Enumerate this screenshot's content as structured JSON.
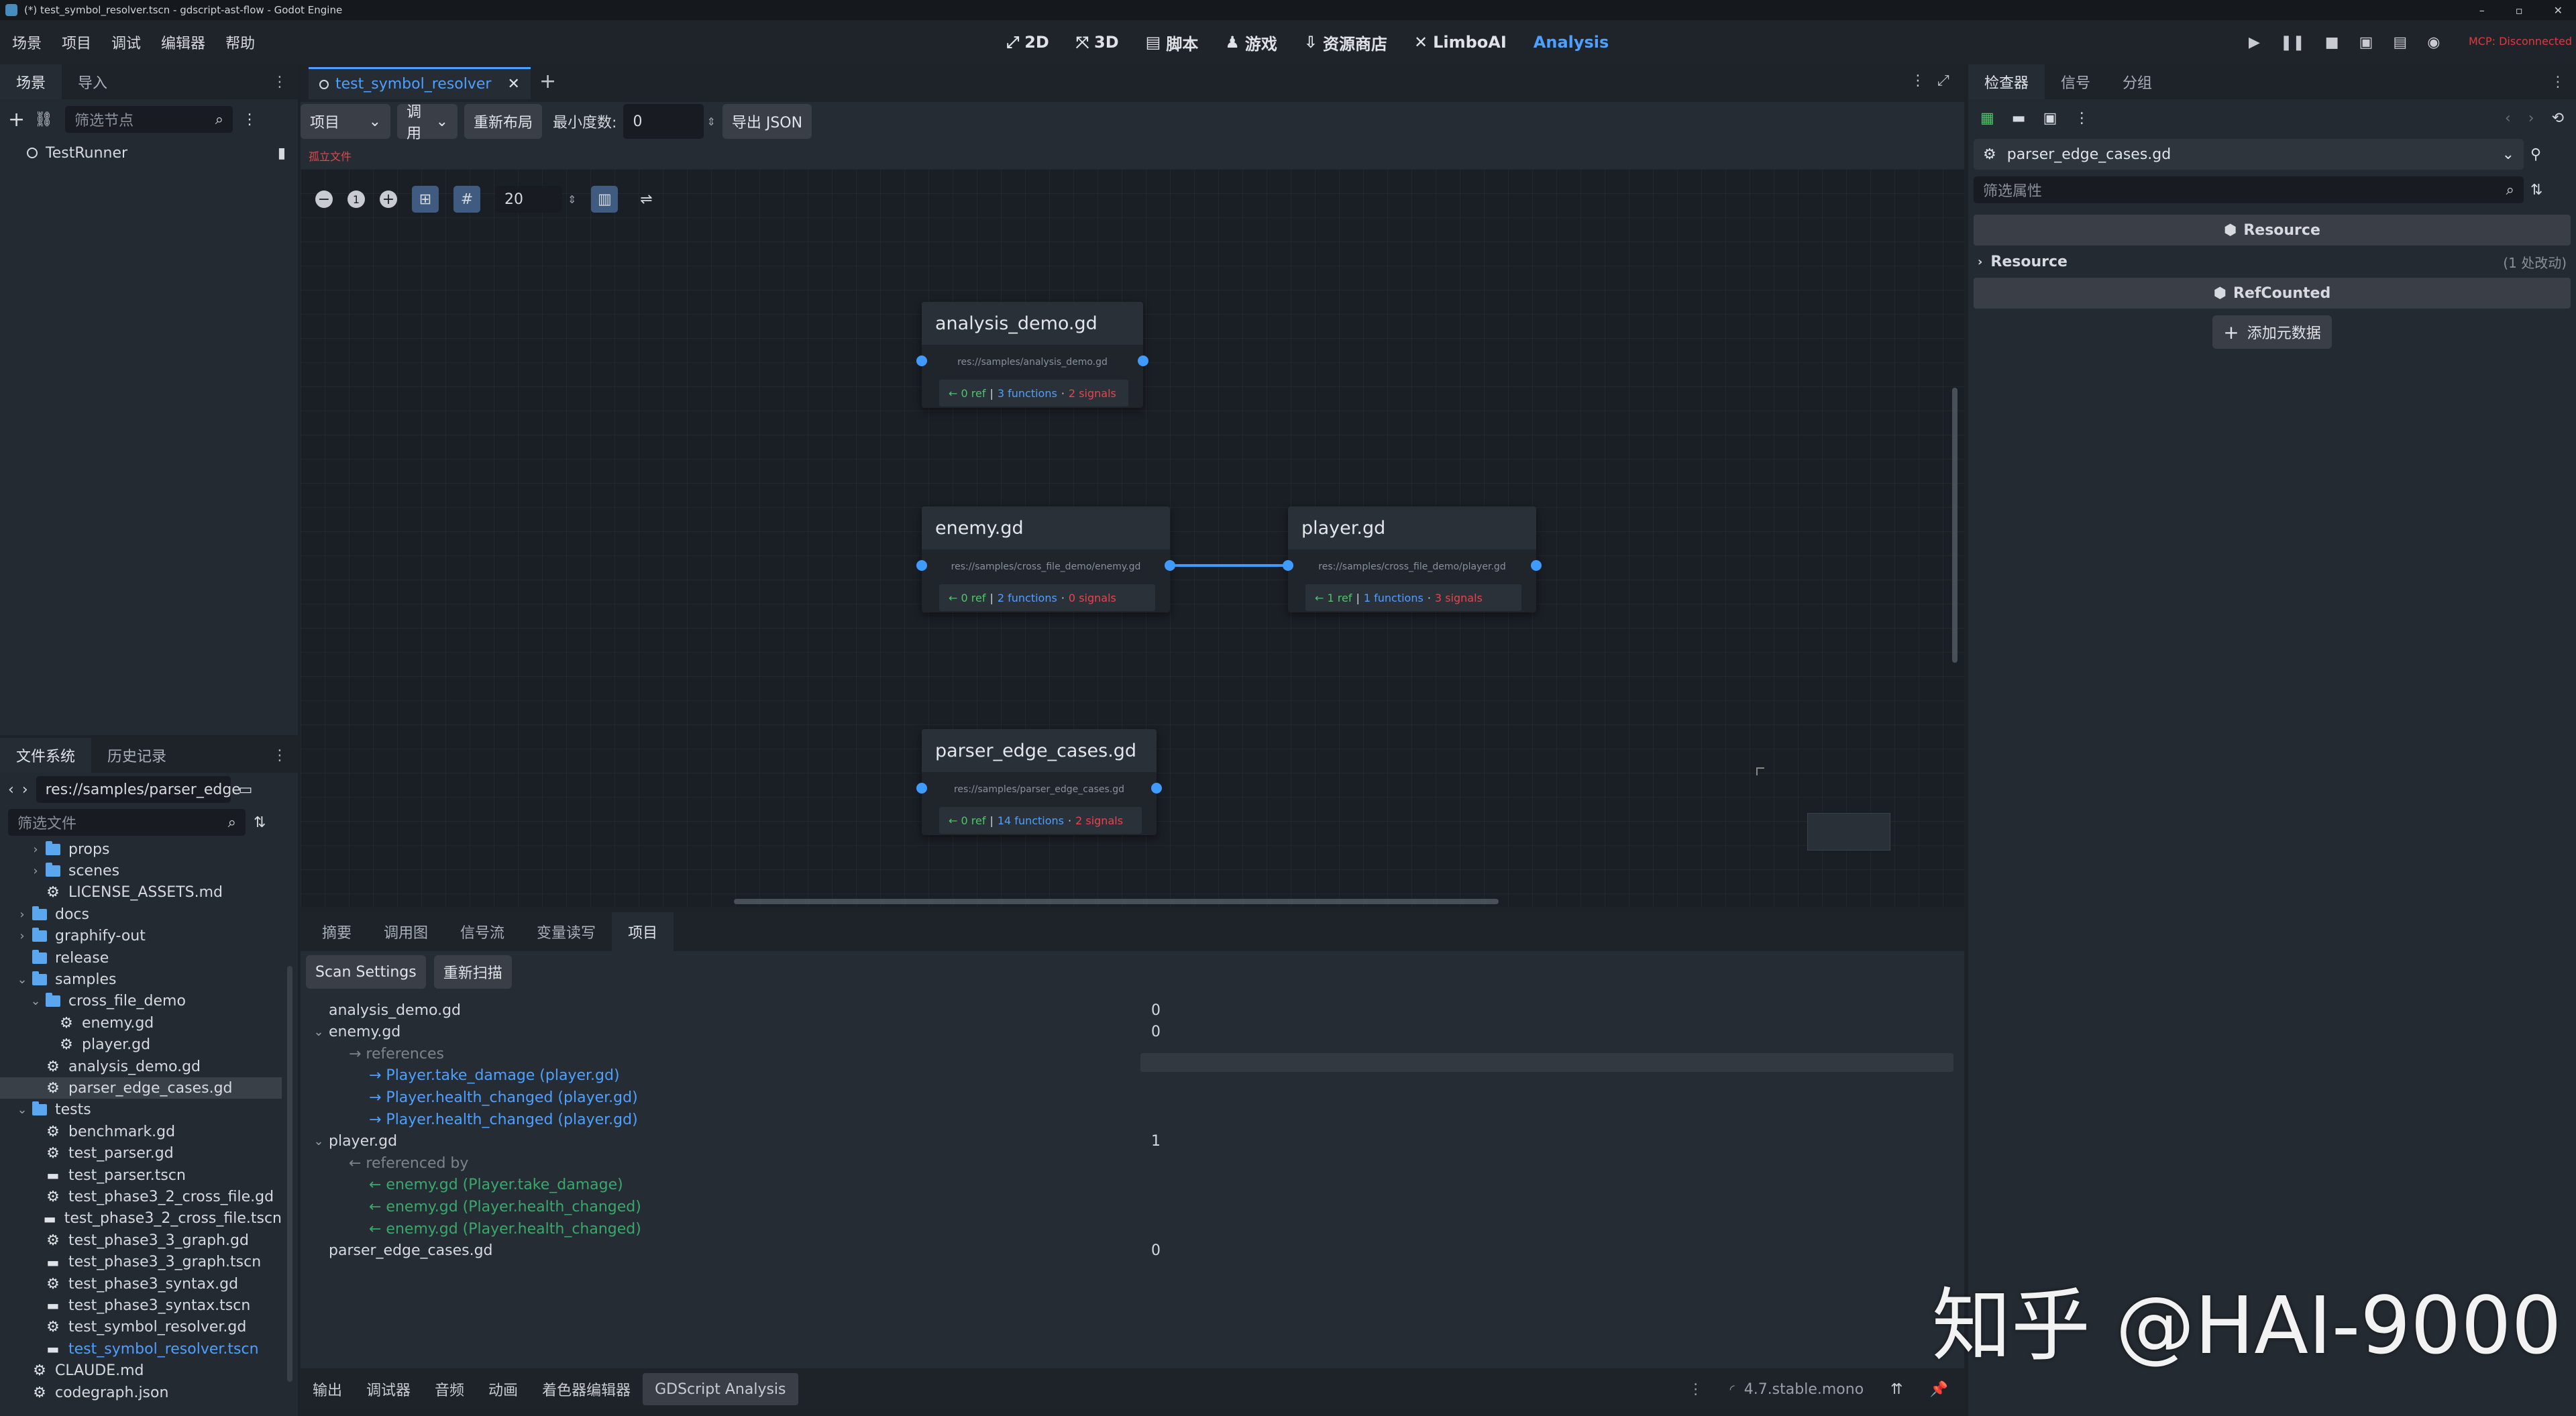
{
  "title_bar": {
    "text": "(*) test_symbol_resolver.tscn - gdscript-ast-flow - Godot Engine",
    "buttons": [
      "minimize-icon",
      "restore-icon",
      "close-icon"
    ]
  },
  "menu": [
    "场景",
    "项目",
    "调试",
    "编辑器",
    "帮助"
  ],
  "workspaces": [
    {
      "label": "2D",
      "icon": "2d-icon"
    },
    {
      "label": "3D",
      "icon": "3d-icon"
    },
    {
      "label": "脚本",
      "icon": "script-icon"
    },
    {
      "label": "游戏",
      "icon": "game-icon"
    },
    {
      "label": "资源商店",
      "icon": "assetlib-icon"
    },
    {
      "label": "LimboAI",
      "icon": "limboai-icon"
    },
    {
      "label": "Analysis",
      "icon": "",
      "active": true
    }
  ],
  "mcp_status": "MCP: Disconnected",
  "colors": {
    "accent": "#4ea0ff",
    "mcp": "#e0393e",
    "green": "#4cc768",
    "red": "#e8454c",
    "link": "#4ea0ff"
  },
  "scene_dock": {
    "tabs": [
      "场景",
      "导入"
    ],
    "filter_placeholder": "筛选节点",
    "root_node": "TestRunner"
  },
  "filesystem_dock": {
    "tabs": [
      "文件系统",
      "历史记录"
    ],
    "path": "res://samples/parser_edge",
    "filter_placeholder": "筛选文件",
    "items": [
      {
        "label": "props",
        "type": "folder",
        "depth": 1,
        "expand": "collapsed"
      },
      {
        "label": "scenes",
        "type": "folder",
        "depth": 1,
        "expand": "collapsed"
      },
      {
        "label": "LICENSE_ASSETS.md",
        "type": "file",
        "depth": 1
      },
      {
        "label": "docs",
        "type": "folder",
        "depth": 0,
        "expand": "collapsed"
      },
      {
        "label": "graphify-out",
        "type": "folder",
        "depth": 0,
        "expand": "collapsed"
      },
      {
        "label": "release",
        "type": "folder",
        "depth": 0
      },
      {
        "label": "samples",
        "type": "folder",
        "depth": 0,
        "expand": "expanded"
      },
      {
        "label": "cross_file_demo",
        "type": "folder",
        "depth": 1,
        "expand": "expanded"
      },
      {
        "label": "enemy.gd",
        "type": "script",
        "depth": 2
      },
      {
        "label": "player.gd",
        "type": "script",
        "depth": 2
      },
      {
        "label": "analysis_demo.gd",
        "type": "script",
        "depth": 1
      },
      {
        "label": "parser_edge_cases.gd",
        "type": "script",
        "depth": 1,
        "selected": true
      },
      {
        "label": "tests",
        "type": "folder",
        "depth": 0,
        "expand": "expanded"
      },
      {
        "label": "benchmark.gd",
        "type": "script",
        "depth": 1
      },
      {
        "label": "test_parser.gd",
        "type": "script",
        "depth": 1
      },
      {
        "label": "test_parser.tscn",
        "type": "scene",
        "depth": 1
      },
      {
        "label": "test_phase3_2_cross_file.gd",
        "type": "script",
        "depth": 1
      },
      {
        "label": "test_phase3_2_cross_file.tscn",
        "type": "scene",
        "depth": 1
      },
      {
        "label": "test_phase3_3_graph.gd",
        "type": "script",
        "depth": 1
      },
      {
        "label": "test_phase3_3_graph.tscn",
        "type": "scene",
        "depth": 1
      },
      {
        "label": "test_phase3_syntax.gd",
        "type": "script",
        "depth": 1
      },
      {
        "label": "test_phase3_syntax.tscn",
        "type": "scene",
        "depth": 1
      },
      {
        "label": "test_symbol_resolver.gd",
        "type": "script",
        "depth": 1
      },
      {
        "label": "test_symbol_resolver.tscn",
        "type": "scene",
        "depth": 1,
        "active": true
      },
      {
        "label": "CLAUDE.md",
        "type": "file",
        "depth": 0
      },
      {
        "label": "codegraph.json",
        "type": "file",
        "depth": 0
      }
    ]
  },
  "editor_tab": {
    "label": "test_symbol_resolver"
  },
  "analysis_toolbar": {
    "scope": "项目",
    "mode": "调用",
    "relayout": "重新布局",
    "min_degree_label": "最小度数:",
    "min_degree_value": "0",
    "export": "导出 JSON",
    "orphan_label": "孤立文件"
  },
  "graph_toolbar": {
    "zoom_value": "20"
  },
  "graph_nodes": [
    {
      "name": "analysis_demo.gd",
      "path": "res://samples/analysis_demo.gd",
      "refs": "← 0 ref",
      "funcs": "3 functions",
      "signals": "2 signals"
    },
    {
      "name": "enemy.gd",
      "path": "res://samples/cross_file_demo/enemy.gd",
      "refs": "← 0 ref",
      "funcs": "2 functions",
      "signals": "0 signals"
    },
    {
      "name": "player.gd",
      "path": "res://samples/cross_file_demo/player.gd",
      "refs": "← 1 ref",
      "funcs": "1 functions",
      "signals": "3 signals"
    },
    {
      "name": "parser_edge_cases.gd",
      "path": "res://samples/parser_edge_cases.gd",
      "refs": "← 0 ref",
      "funcs": "14 functions",
      "signals": "2 signals"
    }
  ],
  "graph_edges": [
    {
      "from": "enemy.gd",
      "to": "player.gd"
    }
  ],
  "bottom_panel": {
    "tabs": [
      "摘要",
      "调用图",
      "信号流",
      "变量读写",
      "项目"
    ],
    "active_tab": "项目",
    "scan_settings": "Scan Settings",
    "rescan": "重新扫描",
    "rows": [
      {
        "label": "analysis_demo.gd",
        "value": "0",
        "indent": 0,
        "kind": "file"
      },
      {
        "label": "enemy.gd",
        "value": "0",
        "indent": 0,
        "kind": "file",
        "expand": "expanded"
      },
      {
        "label": "→ references",
        "value": "",
        "indent": 1,
        "kind": "header"
      },
      {
        "label": "→ Player.take_damage (player.gd)",
        "value": "",
        "indent": 2,
        "kind": "ref-out"
      },
      {
        "label": "→ Player.health_changed (player.gd)",
        "value": "",
        "indent": 2,
        "kind": "ref-out"
      },
      {
        "label": "→ Player.health_changed (player.gd)",
        "value": "",
        "indent": 2,
        "kind": "ref-out"
      },
      {
        "label": "player.gd",
        "value": "1",
        "indent": 0,
        "kind": "file",
        "expand": "expanded"
      },
      {
        "label": "← referenced by",
        "value": "",
        "indent": 1,
        "kind": "header"
      },
      {
        "label": "← enemy.gd (Player.take_damage)",
        "value": "",
        "indent": 2,
        "kind": "ref-in"
      },
      {
        "label": "← enemy.gd (Player.health_changed)",
        "value": "",
        "indent": 2,
        "kind": "ref-in"
      },
      {
        "label": "← enemy.gd (Player.health_changed)",
        "value": "",
        "indent": 2,
        "kind": "ref-in"
      },
      {
        "label": "parser_edge_cases.gd",
        "value": "0",
        "indent": 0,
        "kind": "file"
      }
    ]
  },
  "bottom_tabs": [
    "输出",
    "调试器",
    "音频",
    "动画",
    "着色器编辑器",
    "GDScript Analysis"
  ],
  "bottom_active": "GDScript Analysis",
  "version": "4.7.stable.mono",
  "inspector": {
    "tabs": [
      "检查器",
      "信号",
      "分组"
    ],
    "resource_name": "parser_edge_cases.gd",
    "filter_placeholder": "筛选属性",
    "section_resource": "Resource",
    "group_resource": "Resource",
    "group_resource_note": "(1 处改动)",
    "section_refcounted": "RefCounted",
    "add_metadata": "添加元数据"
  },
  "watermark": "知乎 @HAI-9000"
}
